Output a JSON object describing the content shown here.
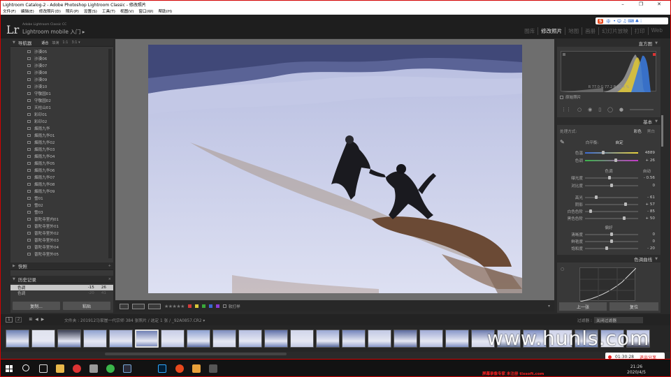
{
  "window": {
    "title": "Lightroom Catalog-2 - Adobe Photoshop Lightroom Classic - 修改照片",
    "min": "–",
    "max": "❐",
    "close": "✕"
  },
  "menu": [
    "文件(F)",
    "编辑(E)",
    "修改照片(D)",
    "照片(P)",
    "设置(S)",
    "工具(T)",
    "视图(V)",
    "窗口(W)",
    "帮助(H)"
  ],
  "ime": {
    "logo": "S",
    "label": "中",
    "icons": "• ☺ ♫ ⌨ ♣ ⁝"
  },
  "identity": {
    "logo": "Lr",
    "product": "Adobe Lightroom Classic CC",
    "mobile": "Lightroom mobile 入门 ▸"
  },
  "modules": [
    {
      "label": "图库",
      "active": false
    },
    {
      "label": "修改照片",
      "active": true
    },
    {
      "label": "地图",
      "active": false
    },
    {
      "label": "画册",
      "active": false
    },
    {
      "label": "幻灯片放映",
      "active": false
    },
    {
      "label": "打印",
      "active": false
    },
    {
      "label": "Web",
      "active": false
    }
  ],
  "left_panel": {
    "navigator": {
      "title": "导航器",
      "options": [
        "适合",
        "填满",
        "1:1",
        "3:1 ▾"
      ]
    },
    "collections": [
      "沙漠05",
      "沙漠06",
      "沙漠07",
      "沙漠08",
      "沙漠09",
      "沙漠10",
      "守敬园01",
      "守敬园02",
      "天柱山01",
      "彩印01",
      "彩印02",
      "烟雨九华",
      "烟雨九华01",
      "烟雨九华02",
      "烟雨九华03",
      "烟雨九华04",
      "烟雨九华05",
      "烟雨九华06",
      "烟雨九华07",
      "烟雨九华08",
      "烟雨九华09",
      "雪01",
      "雪02",
      "雪03",
      "普陀寺室内01",
      "普陀寺室外01",
      "普陀寺室外02",
      "普陀寺室外03",
      "普陀寺室外04",
      "普陀寺室外05"
    ],
    "snapshots": {
      "title": "快照",
      "add": "+"
    },
    "history": {
      "title": "历史记录",
      "close": "×",
      "rows": [
        {
          "label": "色调",
          "a": "-15",
          "b": "26"
        },
        {
          "label": "色调",
          "a": "-20",
          "b": "41"
        }
      ]
    },
    "copy_button": "复制...",
    "paste_button": "粘贴"
  },
  "toolbar": {
    "stars": "★★★★★",
    "flag_colors": [
      "#d23a3a",
      "#d8c73a",
      "#3aa83a",
      "#3a68d2",
      "#8a3ad2"
    ],
    "softproof": "软打样",
    "more": "▾"
  },
  "right_panel": {
    "histogram": {
      "title": "直方图",
      "readout": {
        "r_label": "R",
        "r": "77.0",
        "g_label": "G",
        "g": "77.2",
        "b_label": "B",
        "b": "85.4",
        "unit": "%"
      },
      "original": "原始照片"
    },
    "basic": {
      "title": "基本",
      "treatment_label": "处理方式:",
      "treatment_color": "彩色",
      "treatment_bw": "黑白",
      "wb_label": "白平衡:",
      "wb_value": "自定",
      "tone_label": "色调",
      "tone_auto": "自动",
      "presence_label": "偏好",
      "sliders": {
        "temp": {
          "label": "色温",
          "value": "4889",
          "pos": 0.33
        },
        "tint": {
          "label": "色调",
          "value": "+ 26",
          "pos": 0.58
        },
        "exposure": {
          "label": "曝光度",
          "value": "- 0.56",
          "pos": 0.46
        },
        "contrast": {
          "label": "对比度",
          "value": "0",
          "pos": 0.5
        },
        "highlights": {
          "label": "高光",
          "value": "- 61",
          "pos": 0.2
        },
        "shadows": {
          "label": "阴影",
          "value": "+ 57",
          "pos": 0.78
        },
        "whites": {
          "label": "白色色阶",
          "value": "- 85",
          "pos": 0.08
        },
        "blacks": {
          "label": "黑色色阶",
          "value": "+ 50",
          "pos": 0.75
        },
        "texture": {
          "label": "清晰度",
          "value": "0",
          "pos": 0.5
        },
        "dehaze": {
          "label": "鲜艳度",
          "value": "0",
          "pos": 0.5
        },
        "saturation": {
          "label": "饱和度",
          "value": "- 20",
          "pos": 0.4
        }
      }
    },
    "tone_curve": {
      "title": "色调曲线"
    },
    "prev_button": "上一张",
    "reset_button": "复位"
  },
  "filmstrip": {
    "pages": [
      "1",
      "2"
    ],
    "source": "文件夹 : 201912马家崖一代宗师 384 张照片 / 选定 1 张 / _92A0857.CR2 ▾",
    "filter_label": "过滤器 :",
    "filter_value": "关闭过滤器"
  },
  "watermark": "www.hunls.com",
  "recording": {
    "time": "01:30:28",
    "exit": "退出分享"
  },
  "taskbar": {
    "time": "21:26",
    "date": "2020/4/5",
    "reg": "屏幕录像专家 未注册 tlxsoft.com"
  },
  "colors": {
    "accent": "#d40000",
    "panel": "#383838"
  }
}
